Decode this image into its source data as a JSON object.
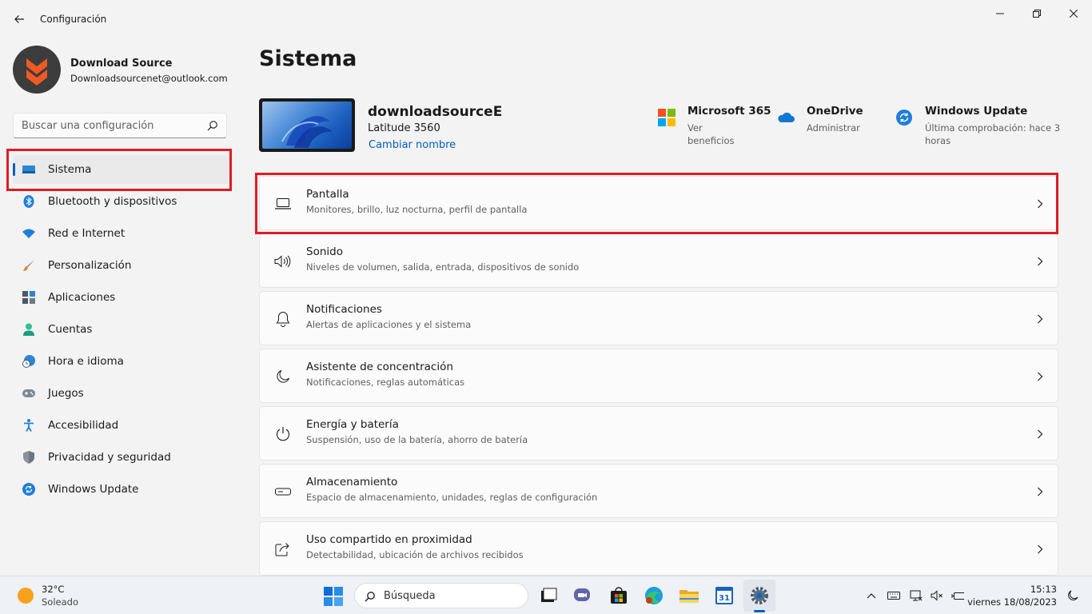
{
  "window": {
    "title": "Configuración"
  },
  "profile": {
    "name": "Download Source",
    "email": "Downloadsourcenet@outlook.com"
  },
  "search": {
    "placeholder": "Buscar una configuración"
  },
  "sidebar": {
    "items": [
      {
        "label": "Sistema",
        "icon": "system-icon",
        "active": true
      },
      {
        "label": "Bluetooth y dispositivos",
        "icon": "bluetooth-icon"
      },
      {
        "label": "Red e Internet",
        "icon": "wifi-icon"
      },
      {
        "label": "Personalización",
        "icon": "brush-icon"
      },
      {
        "label": "Aplicaciones",
        "icon": "apps-icon"
      },
      {
        "label": "Cuentas",
        "icon": "user-icon"
      },
      {
        "label": "Hora e idioma",
        "icon": "clock-globe-icon"
      },
      {
        "label": "Juegos",
        "icon": "gamepad-icon"
      },
      {
        "label": "Accesibilidad",
        "icon": "accessibility-icon"
      },
      {
        "label": "Privacidad y seguridad",
        "icon": "shield-icon"
      },
      {
        "label": "Windows Update",
        "icon": "sync-icon"
      }
    ]
  },
  "main": {
    "title": "Sistema",
    "device": {
      "name": "downloadsourceE",
      "model": "Latitude 3560",
      "rename_label": "Cambiar nombre"
    },
    "quick": [
      {
        "title": "Microsoft 365",
        "sub": "Ver beneficios",
        "icon": "microsoft-logo-icon"
      },
      {
        "title": "OneDrive",
        "sub": "Administrar",
        "icon": "onedrive-cloud-icon"
      },
      {
        "title": "Windows Update",
        "sub": "Última comprobación: hace 3 horas",
        "icon": "windows-update-icon"
      }
    ],
    "cards": [
      {
        "title": "Pantalla",
        "sub": "Monitores, brillo, luz nocturna, perfil de pantalla",
        "icon": "monitor-icon"
      },
      {
        "title": "Sonido",
        "sub": "Niveles de volumen, salida, entrada, dispositivos de sonido",
        "icon": "speaker-icon"
      },
      {
        "title": "Notificaciones",
        "sub": "Alertas de aplicaciones y el sistema",
        "icon": "bell-icon"
      },
      {
        "title": "Asistente de concentración",
        "sub": "Notificaciones, reglas automáticas",
        "icon": "moon-icon"
      },
      {
        "title": "Energía y batería",
        "sub": "Suspensión, uso de la batería, ahorro de batería",
        "icon": "power-icon"
      },
      {
        "title": "Almacenamiento",
        "sub": "Espacio de almacenamiento, unidades, reglas de configuración",
        "icon": "drive-icon"
      },
      {
        "title": "Uso compartido en proximidad",
        "sub": "Detectabilidad, ubicación de archivos recibidos",
        "icon": "share-icon"
      }
    ]
  },
  "taskbar": {
    "weather_temp": "32°C",
    "weather_desc": "Soleado",
    "search_placeholder": "Búsqueda",
    "time": "15:13",
    "date": "viernes 18/08/2023"
  },
  "colors": {
    "accent": "#005fb8",
    "highlight_box": "#e01b24"
  }
}
